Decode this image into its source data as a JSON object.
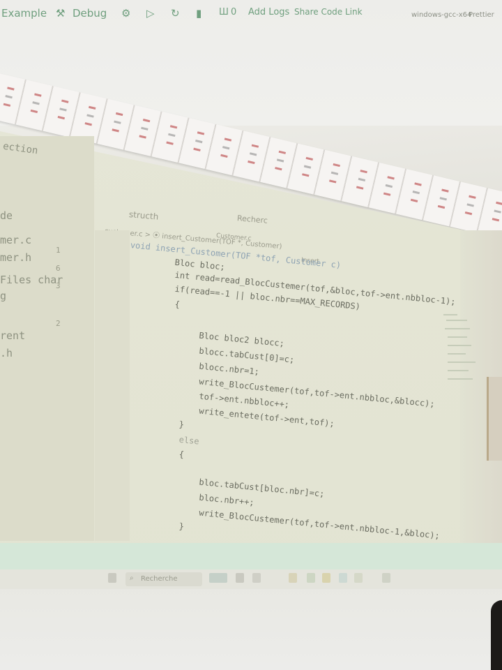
{
  "sidebar": {
    "header": "ection",
    "items": [
      {
        "label": "de"
      },
      {
        "label": "mer.c",
        "num": "1"
      },
      {
        "label": "mer.h",
        "num": "6"
      },
      {
        "label": "Files char",
        "num": "3"
      },
      {
        "label": "g"
      },
      {
        "label": "",
        "num": "2"
      },
      {
        "label": "rent"
      },
      {
        "label": ".h"
      }
    ]
  },
  "editor": {
    "top_label": "structh",
    "search_label": "Recherc",
    "tab_file": "Customer.c",
    "breadcrumb": "customer.c > ⦿ insert_Customer(TOF *, Customer)",
    "outline_label": "Insert",
    "code_lines": [
      "void insert_Customer(TOF *tof, Customer c)",
      "    Bloc bloc;",
      "    int read=read_BlocCustemer(tof,&bloc,tof->ent.nbbloc-1);",
      "    if(read==-1 || bloc.nbr==MAX_RECORDS)",
      "    {",
      "        Bloc bloc2 blocc;",
      "        blocc.tabCust[0]=c;",
      "        blocc.nbr=1;",
      "        write_BlocCustemer(tof,tof->ent.nbbloc,&blocc);",
      "        tof->ent.nbbloc++;",
      "        write_entete(tof->ent,tof);",
      "    }",
      "    else",
      "    {",
      "",
      "        bloc.tabCust[bloc.nbr]=c;",
      "        bloc.nbr++;",
      "        write_BlocCustemer(tof,tof->ent.nbbloc-1,&bloc);",
      "    }"
    ]
  },
  "statusbar": {
    "example": "Example",
    "debug": "Debug",
    "zero_count": "0",
    "add_logs": "Add Logs",
    "share": "Share Code Link",
    "platform": "windows-gcc-x64",
    "prettier": "Prettier"
  },
  "taskbar": {
    "search_placeholder": "Recherche"
  }
}
